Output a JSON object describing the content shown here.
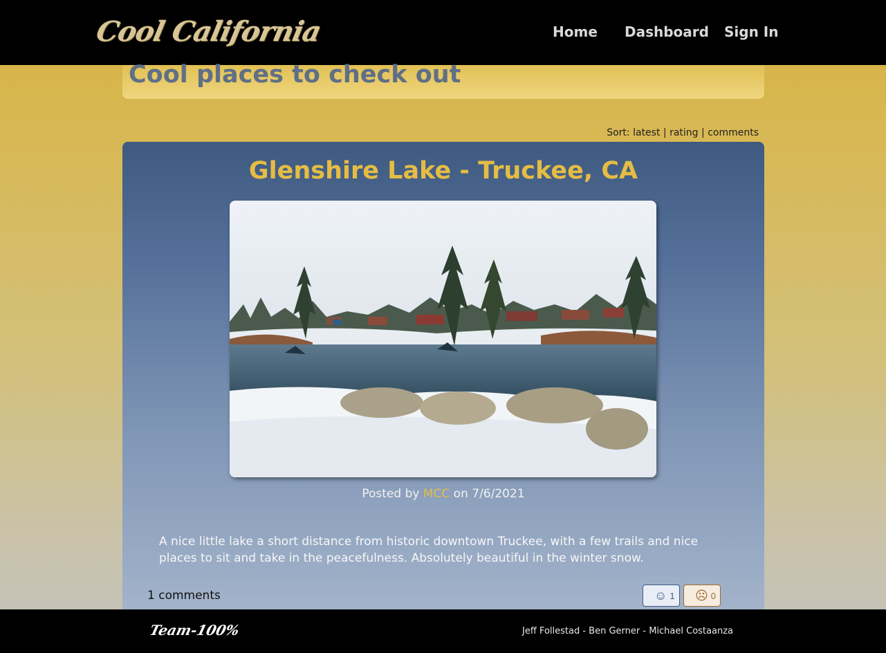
{
  "header": {
    "logo": "Cool California",
    "nav": {
      "home": "Home",
      "dashboard": "Dashboard",
      "sign_in": "Sign In"
    }
  },
  "page": {
    "title": "Cool places to check out",
    "sort": {
      "label": "Sort:",
      "options": [
        "latest",
        "rating",
        "comments"
      ],
      "separator": "|"
    }
  },
  "post": {
    "title": "Glenshire Lake - Truckee, CA",
    "posted_by_prefix": "Posted by",
    "author": "MCC",
    "date_prefix": "on",
    "date": "7/6/2021",
    "description": "A nice little lake a short distance from historic downtown Truckee, with a few trails and nice places to sit and take in the peacefulness. Absolutely beautiful in the winter snow.",
    "comments_label": "1 comments",
    "votes": {
      "up_count": "1",
      "down_count": "0",
      "up_icon": "smile-icon",
      "down_icon": "frown-icon"
    }
  },
  "footer": {
    "team": "Team-100%",
    "credits": "Jeff Follestad - Ben Gerner - Michael Costaanza"
  },
  "colors": {
    "accent_gold": "#e2bd47",
    "header_bg": "#000000",
    "card_top": "#3f5a80"
  }
}
